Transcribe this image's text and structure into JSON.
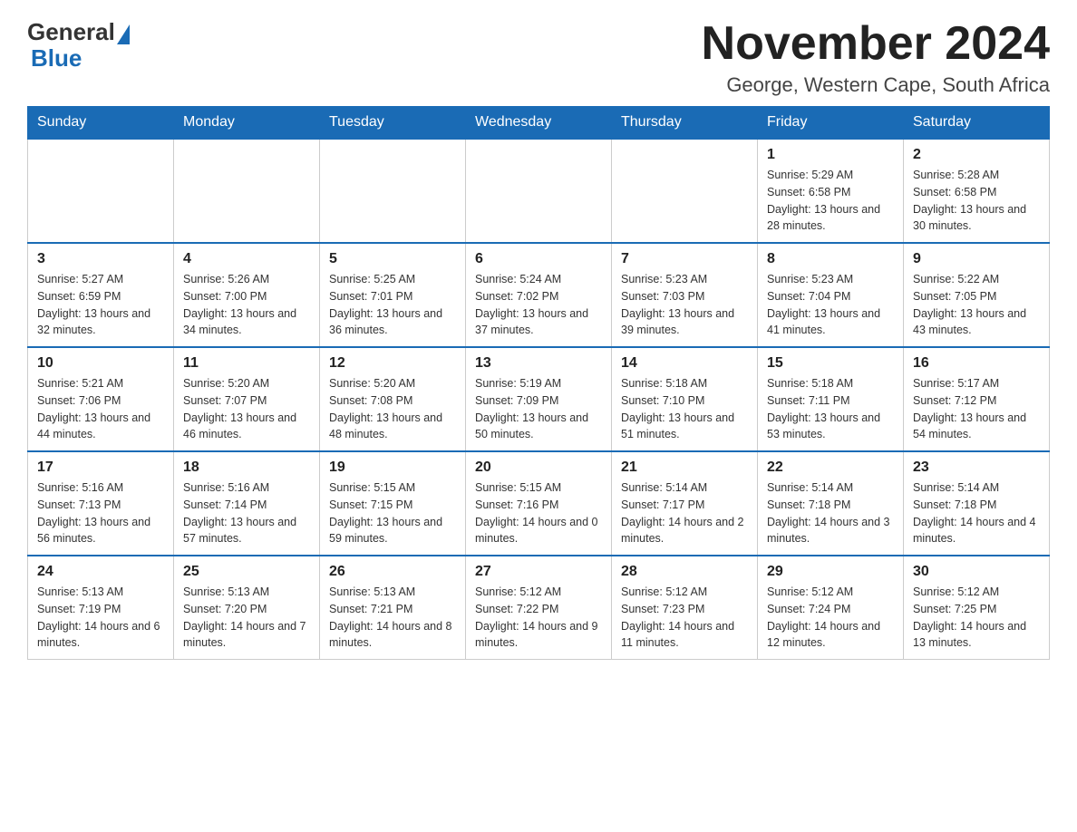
{
  "header": {
    "title": "November 2024",
    "location": "George, Western Cape, South Africa",
    "logo_general": "General",
    "logo_blue": "Blue"
  },
  "days_of_week": [
    "Sunday",
    "Monday",
    "Tuesday",
    "Wednesday",
    "Thursday",
    "Friday",
    "Saturday"
  ],
  "weeks": [
    {
      "days": [
        {
          "number": "",
          "info": ""
        },
        {
          "number": "",
          "info": ""
        },
        {
          "number": "",
          "info": ""
        },
        {
          "number": "",
          "info": ""
        },
        {
          "number": "",
          "info": ""
        },
        {
          "number": "1",
          "info": "Sunrise: 5:29 AM\nSunset: 6:58 PM\nDaylight: 13 hours and 28 minutes."
        },
        {
          "number": "2",
          "info": "Sunrise: 5:28 AM\nSunset: 6:58 PM\nDaylight: 13 hours and 30 minutes."
        }
      ]
    },
    {
      "days": [
        {
          "number": "3",
          "info": "Sunrise: 5:27 AM\nSunset: 6:59 PM\nDaylight: 13 hours and 32 minutes."
        },
        {
          "number": "4",
          "info": "Sunrise: 5:26 AM\nSunset: 7:00 PM\nDaylight: 13 hours and 34 minutes."
        },
        {
          "number": "5",
          "info": "Sunrise: 5:25 AM\nSunset: 7:01 PM\nDaylight: 13 hours and 36 minutes."
        },
        {
          "number": "6",
          "info": "Sunrise: 5:24 AM\nSunset: 7:02 PM\nDaylight: 13 hours and 37 minutes."
        },
        {
          "number": "7",
          "info": "Sunrise: 5:23 AM\nSunset: 7:03 PM\nDaylight: 13 hours and 39 minutes."
        },
        {
          "number": "8",
          "info": "Sunrise: 5:23 AM\nSunset: 7:04 PM\nDaylight: 13 hours and 41 minutes."
        },
        {
          "number": "9",
          "info": "Sunrise: 5:22 AM\nSunset: 7:05 PM\nDaylight: 13 hours and 43 minutes."
        }
      ]
    },
    {
      "days": [
        {
          "number": "10",
          "info": "Sunrise: 5:21 AM\nSunset: 7:06 PM\nDaylight: 13 hours and 44 minutes."
        },
        {
          "number": "11",
          "info": "Sunrise: 5:20 AM\nSunset: 7:07 PM\nDaylight: 13 hours and 46 minutes."
        },
        {
          "number": "12",
          "info": "Sunrise: 5:20 AM\nSunset: 7:08 PM\nDaylight: 13 hours and 48 minutes."
        },
        {
          "number": "13",
          "info": "Sunrise: 5:19 AM\nSunset: 7:09 PM\nDaylight: 13 hours and 50 minutes."
        },
        {
          "number": "14",
          "info": "Sunrise: 5:18 AM\nSunset: 7:10 PM\nDaylight: 13 hours and 51 minutes."
        },
        {
          "number": "15",
          "info": "Sunrise: 5:18 AM\nSunset: 7:11 PM\nDaylight: 13 hours and 53 minutes."
        },
        {
          "number": "16",
          "info": "Sunrise: 5:17 AM\nSunset: 7:12 PM\nDaylight: 13 hours and 54 minutes."
        }
      ]
    },
    {
      "days": [
        {
          "number": "17",
          "info": "Sunrise: 5:16 AM\nSunset: 7:13 PM\nDaylight: 13 hours and 56 minutes."
        },
        {
          "number": "18",
          "info": "Sunrise: 5:16 AM\nSunset: 7:14 PM\nDaylight: 13 hours and 57 minutes."
        },
        {
          "number": "19",
          "info": "Sunrise: 5:15 AM\nSunset: 7:15 PM\nDaylight: 13 hours and 59 minutes."
        },
        {
          "number": "20",
          "info": "Sunrise: 5:15 AM\nSunset: 7:16 PM\nDaylight: 14 hours and 0 minutes."
        },
        {
          "number": "21",
          "info": "Sunrise: 5:14 AM\nSunset: 7:17 PM\nDaylight: 14 hours and 2 minutes."
        },
        {
          "number": "22",
          "info": "Sunrise: 5:14 AM\nSunset: 7:18 PM\nDaylight: 14 hours and 3 minutes."
        },
        {
          "number": "23",
          "info": "Sunrise: 5:14 AM\nSunset: 7:18 PM\nDaylight: 14 hours and 4 minutes."
        }
      ]
    },
    {
      "days": [
        {
          "number": "24",
          "info": "Sunrise: 5:13 AM\nSunset: 7:19 PM\nDaylight: 14 hours and 6 minutes."
        },
        {
          "number": "25",
          "info": "Sunrise: 5:13 AM\nSunset: 7:20 PM\nDaylight: 14 hours and 7 minutes."
        },
        {
          "number": "26",
          "info": "Sunrise: 5:13 AM\nSunset: 7:21 PM\nDaylight: 14 hours and 8 minutes."
        },
        {
          "number": "27",
          "info": "Sunrise: 5:12 AM\nSunset: 7:22 PM\nDaylight: 14 hours and 9 minutes."
        },
        {
          "number": "28",
          "info": "Sunrise: 5:12 AM\nSunset: 7:23 PM\nDaylight: 14 hours and 11 minutes."
        },
        {
          "number": "29",
          "info": "Sunrise: 5:12 AM\nSunset: 7:24 PM\nDaylight: 14 hours and 12 minutes."
        },
        {
          "number": "30",
          "info": "Sunrise: 5:12 AM\nSunset: 7:25 PM\nDaylight: 14 hours and 13 minutes."
        }
      ]
    }
  ]
}
